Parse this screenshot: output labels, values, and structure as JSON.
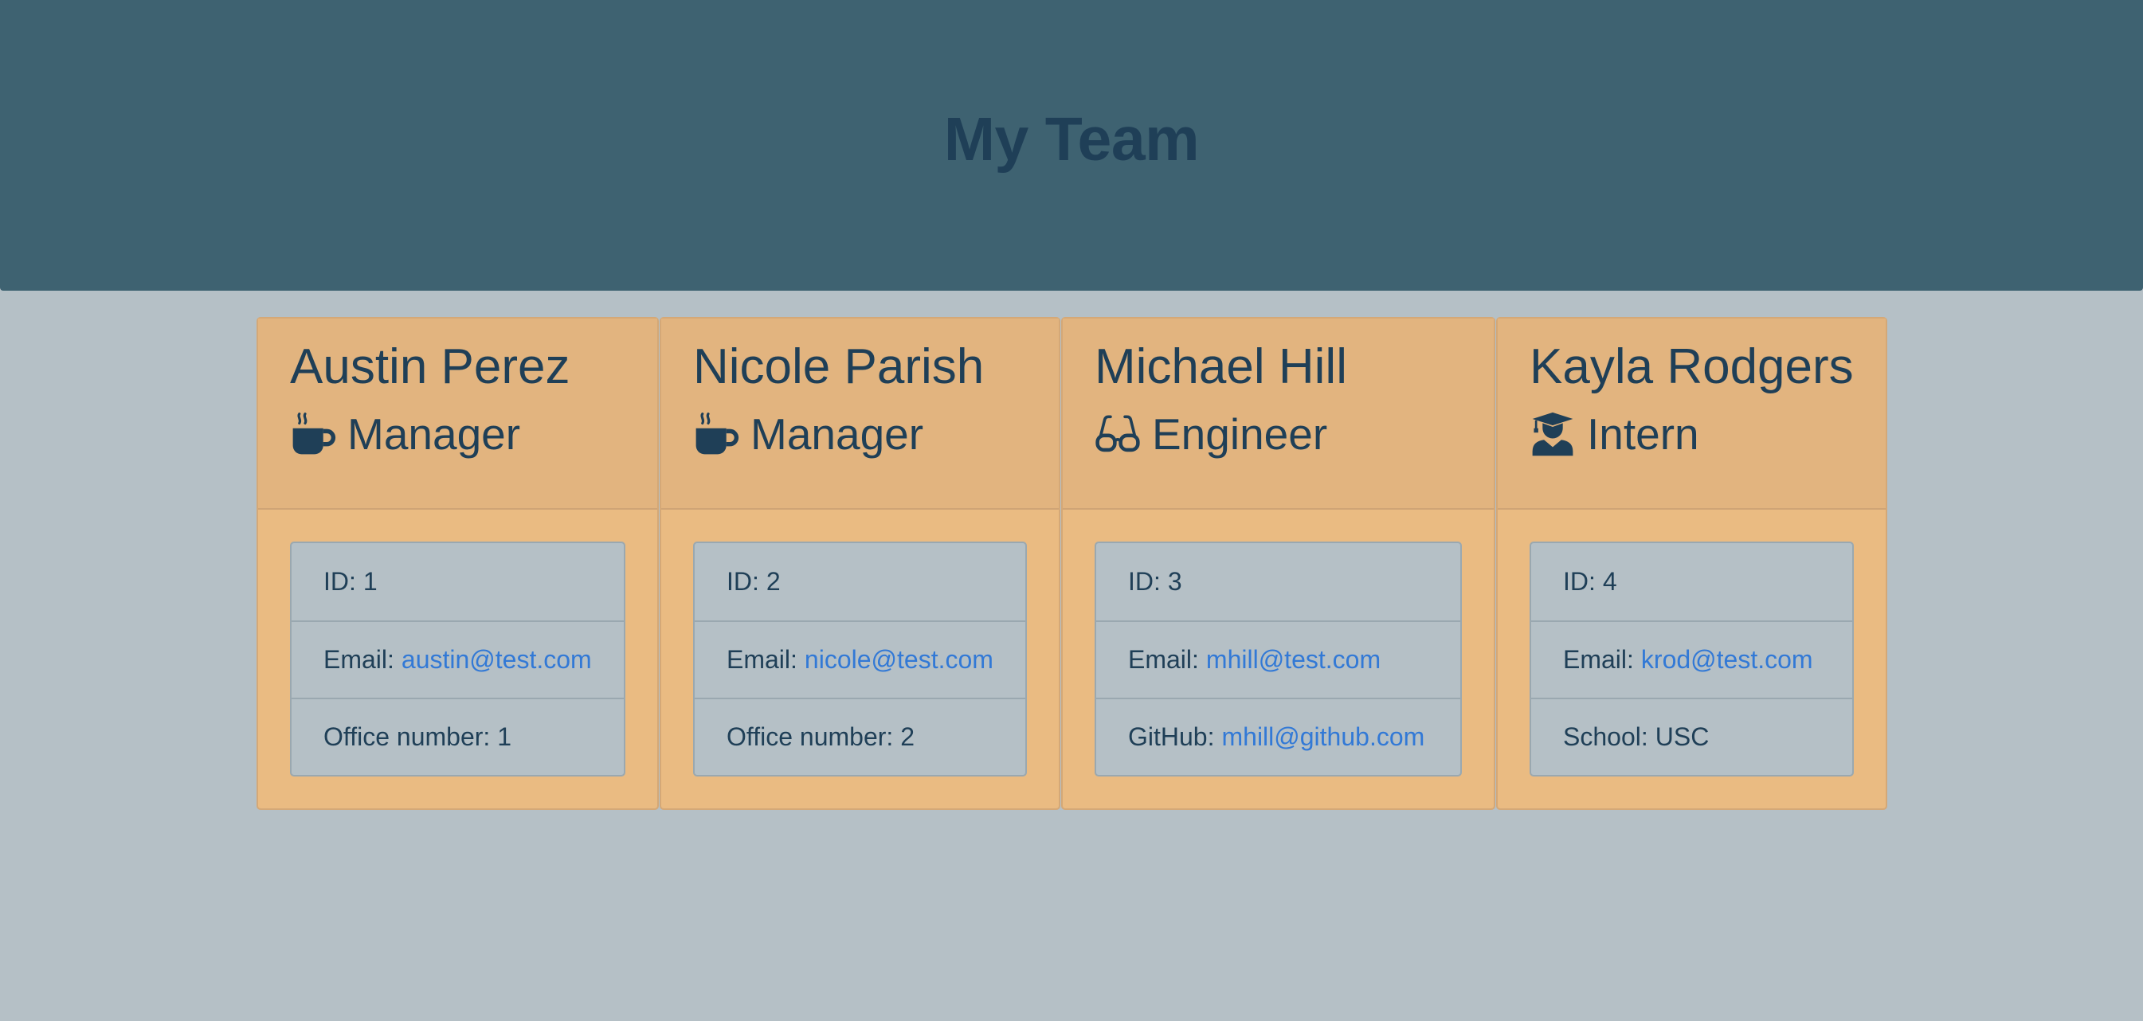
{
  "header": {
    "title": "My Team"
  },
  "colors": {
    "header_bg": "#3e6271",
    "page_bg": "#b5c0c6",
    "card_bg": "#eabb82",
    "card_header_bg": "#e2b47f",
    "text": "#1f3f57",
    "link": "#3279d6"
  },
  "cards": [
    {
      "name": "Austin Perez",
      "role": "Manager",
      "icon": "mug-hot-icon",
      "id_label": "ID:",
      "id": "1",
      "email_label": "Email:",
      "email": "austin@test.com",
      "extra_label": "Office number:",
      "extra": "1"
    },
    {
      "name": "Nicole Parish",
      "role": "Manager",
      "icon": "mug-hot-icon",
      "id_label": "ID:",
      "id": "2",
      "email_label": "Email:",
      "email": "nicole@test.com",
      "extra_label": "Office number:",
      "extra": "2"
    },
    {
      "name": "Michael Hill",
      "role": "Engineer",
      "icon": "glasses-icon",
      "id_label": "ID:",
      "id": "3",
      "email_label": "Email:",
      "email": "mhill@test.com",
      "extra_label": "GitHub:",
      "extra": "mhill@github.com"
    },
    {
      "name": "Kayla Rodgers",
      "role": "Intern",
      "icon": "graduate-icon",
      "id_label": "ID:",
      "id": "4",
      "email_label": "Email:",
      "email": "krod@test.com",
      "extra_label": "School:",
      "extra": "USC"
    }
  ]
}
